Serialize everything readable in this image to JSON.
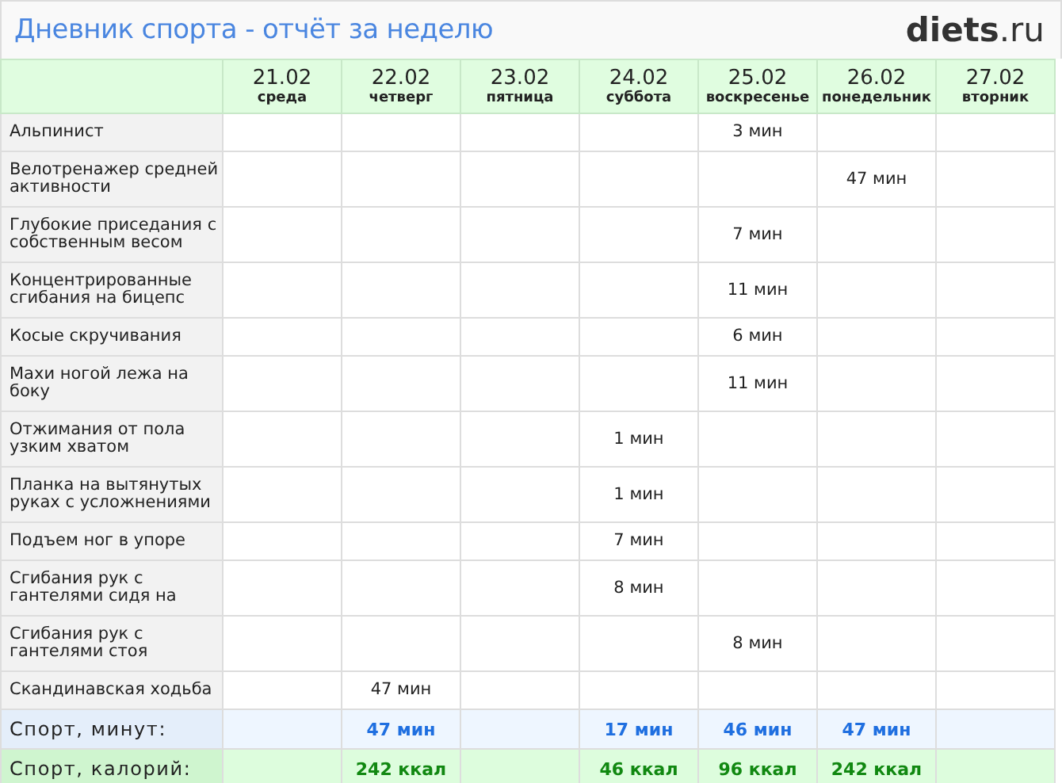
{
  "header": {
    "title": "Дневник спорта - отчёт за неделю",
    "logo": "**diets**.ru"
  },
  "days": [
    {
      "date": "21.02",
      "weekday": "среда"
    },
    {
      "date": "22.02",
      "weekday": "четверг"
    },
    {
      "date": "23.02",
      "weekday": "пятница"
    },
    {
      "date": "24.02",
      "weekday": "суббота"
    },
    {
      "date": "25.02",
      "weekday": "воскресенье"
    },
    {
      "date": "26.02",
      "weekday": "понедельник"
    },
    {
      "date": "27.02",
      "weekday": "вторник"
    }
  ],
  "rows": [
    {
      "kind": "exercise",
      "name": "Альпинист",
      "cells": [
        null,
        null,
        null,
        null,
        "3 мин",
        null,
        null
      ]
    },
    {
      "kind": "exercise",
      "name": "Велотренажер средней активности",
      "cells": [
        null,
        null,
        null,
        null,
        null,
        "47 мин",
        null
      ]
    },
    {
      "kind": "exercise",
      "name": "Глубокие приседания с собственным весом",
      "cells": [
        null,
        null,
        null,
        null,
        "7 мин",
        null,
        null
      ]
    },
    {
      "kind": "exercise",
      "name": "Концентрированные сгибания на бицепс",
      "cells": [
        null,
        null,
        null,
        null,
        "11 мин",
        null,
        null
      ]
    },
    {
      "kind": "exercise",
      "name": "Косые скручивания",
      "cells": [
        null,
        null,
        null,
        null,
        "6 мин",
        null,
        null
      ]
    },
    {
      "kind": "exercise",
      "name": "Махи ногой лежа на боку",
      "cells": [
        null,
        null,
        null,
        null,
        "11 мин",
        null,
        null
      ]
    },
    {
      "kind": "exercise",
      "name": "Отжимания от пола узким хватом",
      "cells": [
        null,
        null,
        null,
        "1 мин",
        null,
        null,
        null
      ]
    },
    {
      "kind": "exercise",
      "name": "Планка на вытянутых руках с усложнениями",
      "cells": [
        null,
        null,
        null,
        "1 мин",
        null,
        null,
        null
      ]
    },
    {
      "kind": "exercise",
      "name": "Подъем ног в упоре",
      "cells": [
        null,
        null,
        null,
        "7 мин",
        null,
        null,
        null
      ]
    },
    {
      "kind": "exercise",
      "name": "Сгибания рук с гантелями сидя на",
      "cells": [
        null,
        null,
        null,
        "8 мин",
        null,
        null,
        null
      ]
    },
    {
      "kind": "exercise",
      "name": "Сгибания рук с гантелями стоя",
      "cells": [
        null,
        null,
        null,
        null,
        "8 мин",
        null,
        null
      ]
    },
    {
      "kind": "exercise",
      "name": "Скандинавская ходьба",
      "cells": [
        null,
        "47 мин",
        null,
        null,
        null,
        null,
        null
      ]
    },
    {
      "kind": "minutes",
      "name": "Спорт, минут:",
      "cells": [
        null,
        "47 мин",
        null,
        "17 мин",
        "46 мин",
        "47 мин",
        null
      ]
    },
    {
      "kind": "calories",
      "name": "Спорт, калорий:",
      "cells": [
        null,
        "242 ккал",
        null,
        "46 ккал",
        "96 ккал",
        "242 ккал",
        null
      ]
    }
  ]
}
